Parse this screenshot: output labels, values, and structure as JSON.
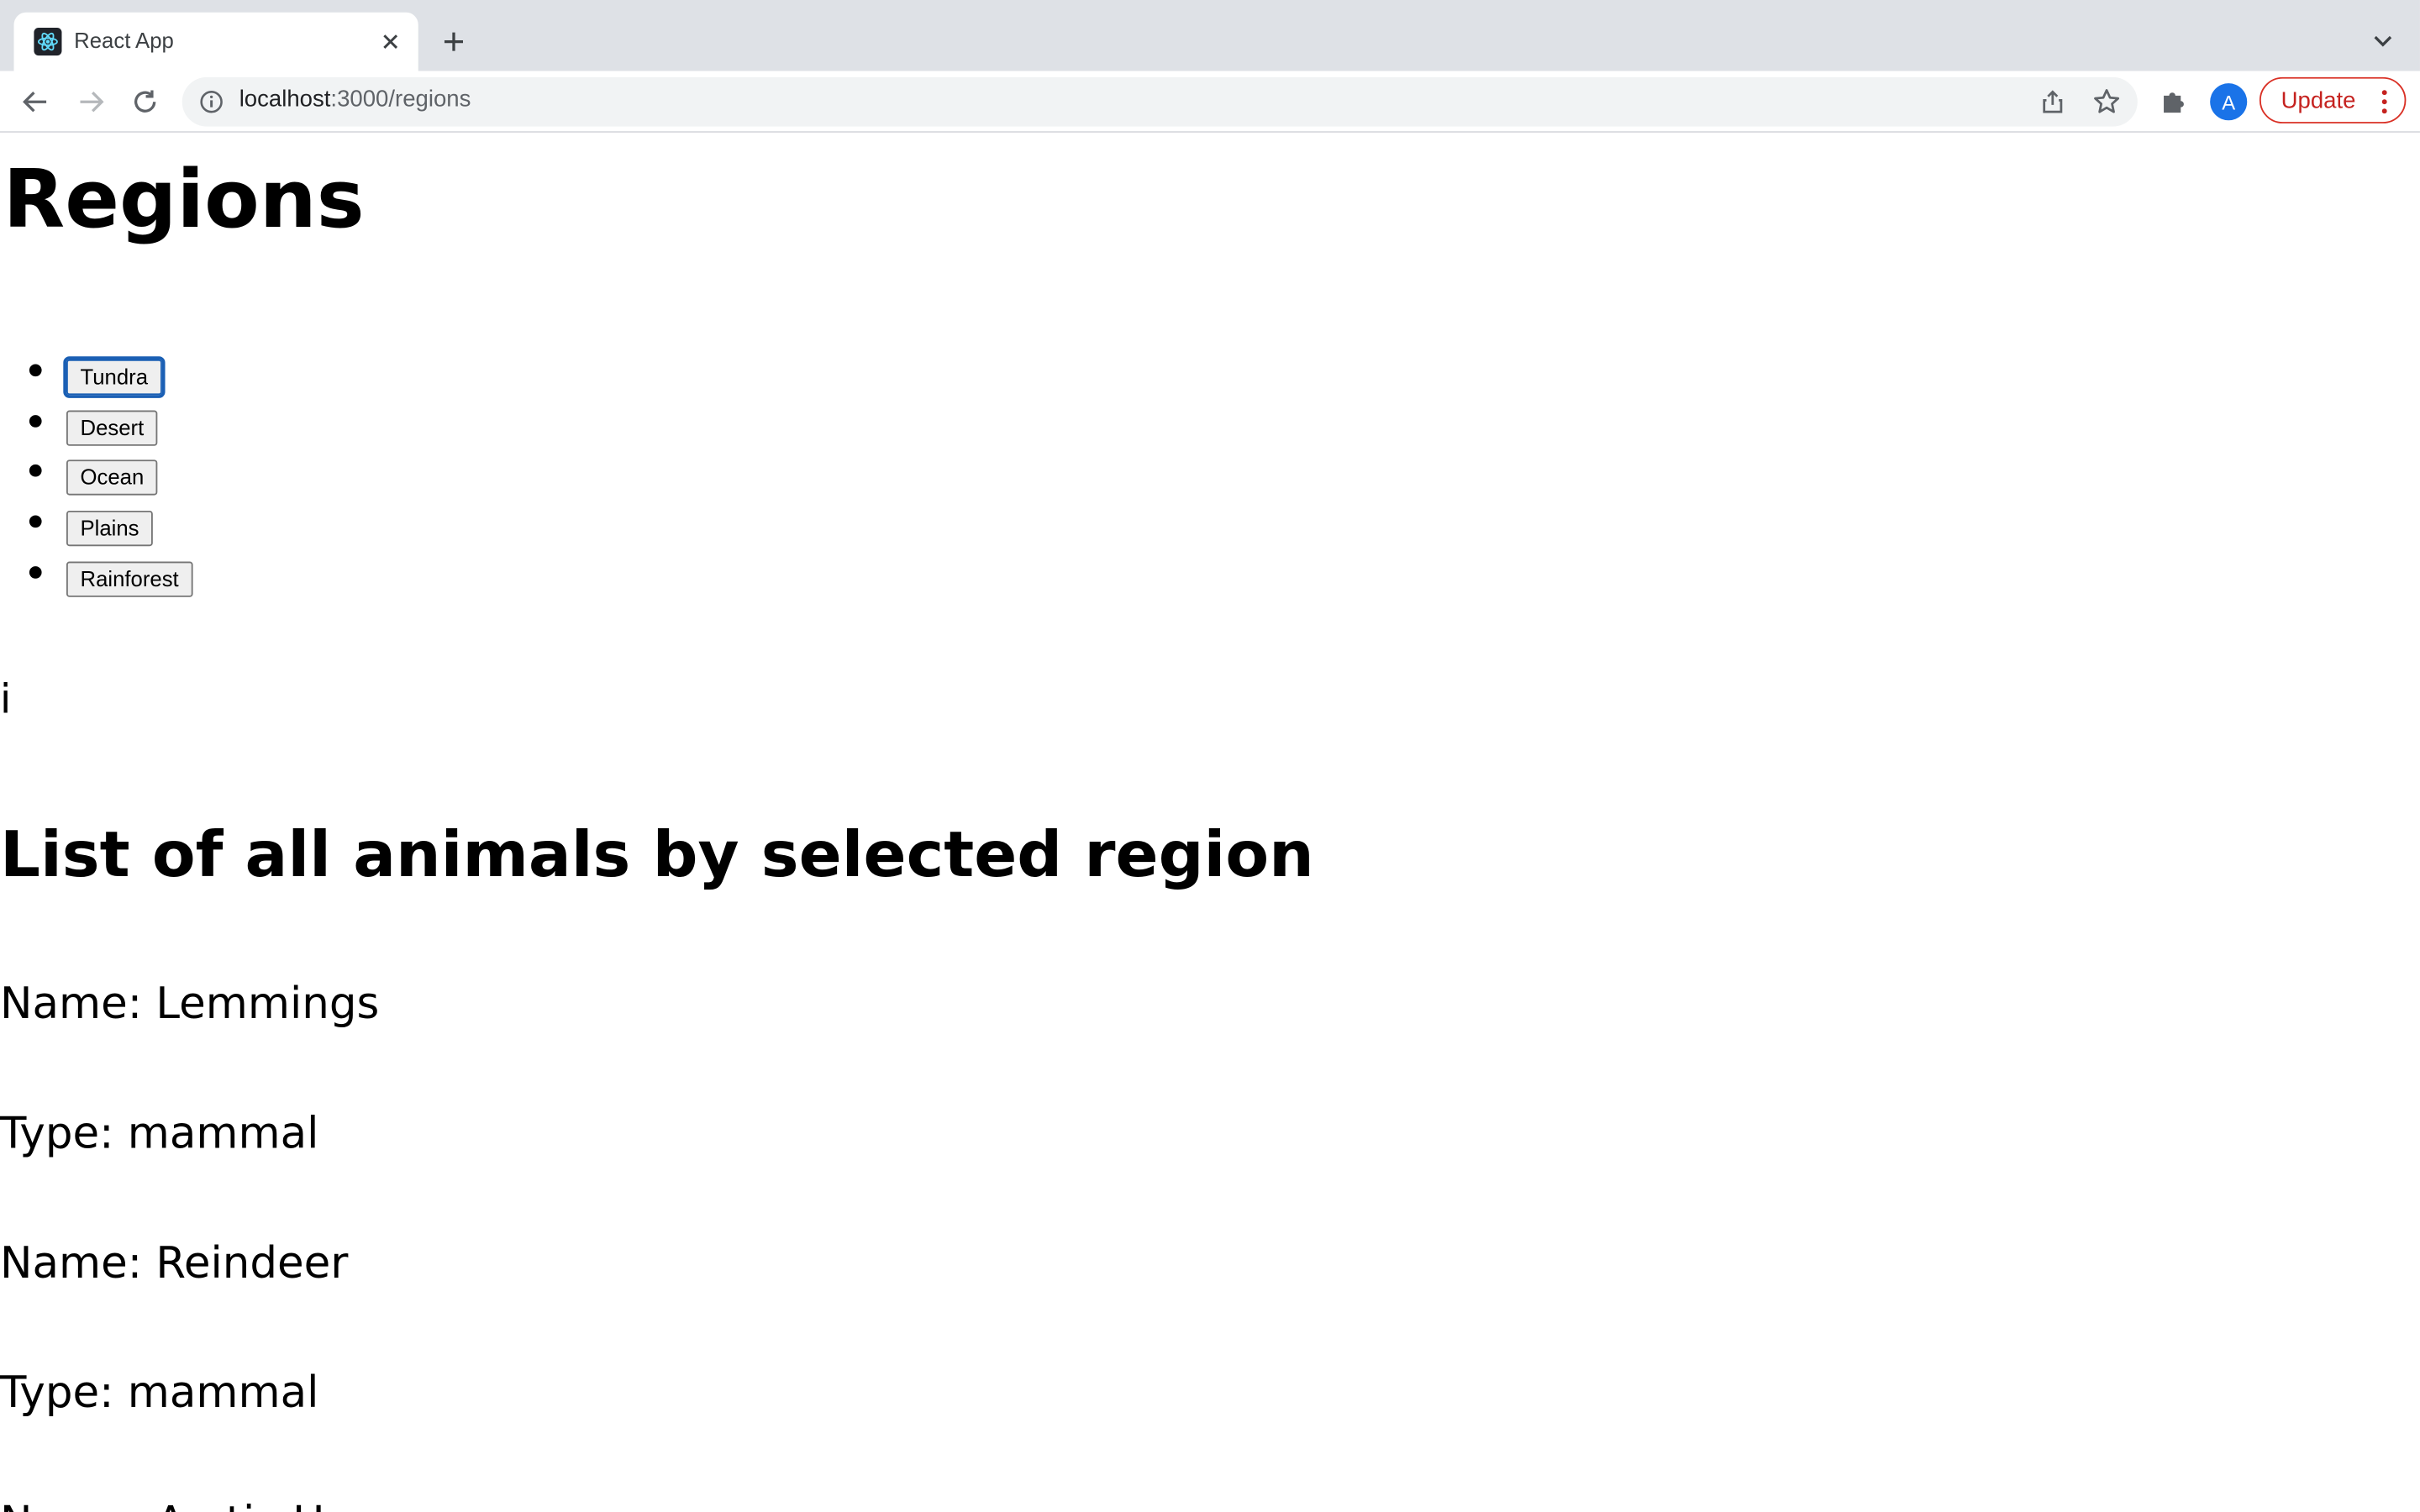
{
  "browser": {
    "tab_title": "React App",
    "url_host": "localhost",
    "url_path": ":3000/regions",
    "avatar_letter": "A",
    "update_label": "Update",
    "accent": "#1a73e8",
    "update_color": "#c5221f"
  },
  "page": {
    "title": "Regions",
    "regions": [
      {
        "label": "Tundra",
        "focused": true
      },
      {
        "label": "Desert"
      },
      {
        "label": "Ocean"
      },
      {
        "label": "Plains"
      },
      {
        "label": "Rainforest"
      }
    ],
    "param_text": "i",
    "list_heading": "List of all animals by selected region",
    "animals": [
      {
        "name_line": "Name: Lemmings",
        "type_line": "Type: mammal"
      },
      {
        "name_line": "Name: Reindeer",
        "type_line": "Type: mammal"
      },
      {
        "name_line": "Name: Arctic Hare"
      }
    ]
  },
  "icons": {
    "tab_favicon": "react-atom-icon",
    "tab_close": "close-icon",
    "new_tab": "plus-icon",
    "tab_menu": "chevron-down-icon",
    "back": "arrow-left-icon",
    "forward": "arrow-right-icon",
    "reload": "reload-icon",
    "site_info": "info-icon",
    "share": "share-icon",
    "bookmark": "star-icon",
    "extensions": "puzzle-icon",
    "menu": "kebab-menu-icon"
  }
}
